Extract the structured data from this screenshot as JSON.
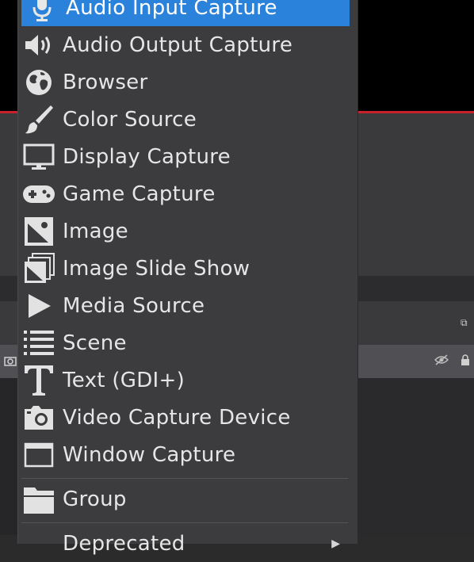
{
  "menu": {
    "items": [
      {
        "label": "Audio Input Capture",
        "icon": "microphone-icon",
        "active": true
      },
      {
        "label": "Audio Output Capture",
        "icon": "speaker-icon"
      },
      {
        "label": "Browser",
        "icon": "globe-icon"
      },
      {
        "label": "Color Source",
        "icon": "paintbrush-icon"
      },
      {
        "label": "Display Capture",
        "icon": "monitor-icon"
      },
      {
        "label": "Game Capture",
        "icon": "gamepad-icon"
      },
      {
        "label": "Image",
        "icon": "image-icon"
      },
      {
        "label": "Image Slide Show",
        "icon": "slideshow-icon"
      },
      {
        "label": "Media Source",
        "icon": "play-icon"
      },
      {
        "label": "Scene",
        "icon": "list-icon"
      },
      {
        "label": "Text (GDI+)",
        "icon": "text-icon"
      },
      {
        "label": "Video Capture Device",
        "icon": "camera-icon"
      },
      {
        "label": "Window Capture",
        "icon": "window-icon"
      }
    ],
    "group": {
      "label": "Group",
      "icon": "folder-icon"
    },
    "deprecated": {
      "label": "Deprecated",
      "icon": "chevron-right-icon"
    }
  },
  "colors": {
    "menu_bg": "#3c3c3f",
    "highlight": "#2a82da",
    "text": "#e6e6e6",
    "accent_red": "#c8232c"
  }
}
